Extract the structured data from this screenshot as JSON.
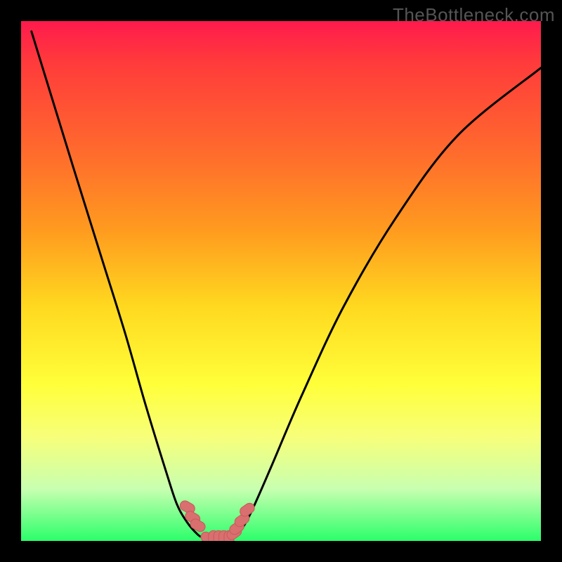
{
  "watermark": "TheBottleneck.com",
  "chart_data": {
    "type": "line",
    "title": "",
    "xlabel": "",
    "ylabel": "",
    "xlim": [
      0,
      100
    ],
    "ylim": [
      0,
      100
    ],
    "series": [
      {
        "name": "left-curve",
        "x": [
          2,
          6,
          10,
          15,
          20,
          24,
          28,
          30,
          32,
          34,
          35,
          36
        ],
        "y": [
          98,
          85,
          72,
          56,
          40,
          26,
          13,
          7,
          3.5,
          1.2,
          0.6,
          0.2
        ]
      },
      {
        "name": "right-curve",
        "x": [
          40,
          42,
          44,
          48,
          54,
          62,
          72,
          84,
          100
        ],
        "y": [
          0.2,
          1.8,
          5,
          14,
          28,
          45,
          62,
          78,
          91
        ]
      },
      {
        "name": "floor",
        "x": [
          36,
          40
        ],
        "y": [
          0.2,
          0.2
        ]
      },
      {
        "name": "marker-group",
        "x": [
          32,
          33,
          34,
          36,
          37,
          38,
          39,
          40,
          41,
          41.5,
          42.5,
          43.5
        ],
        "y": [
          6.5,
          4.5,
          3,
          0.5,
          0.5,
          0.5,
          0.5,
          0.5,
          1.5,
          2.5,
          4,
          6
        ]
      }
    ],
    "colors": {
      "curve": "#000000",
      "marker_fill": "#d96f6f",
      "marker_stroke": "#c85a5a"
    }
  }
}
